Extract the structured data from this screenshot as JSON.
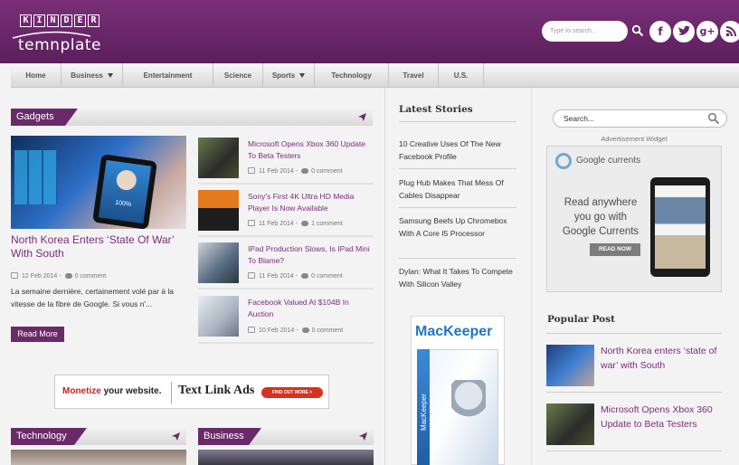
{
  "logo": {
    "top_letters": [
      "K",
      "I",
      "N",
      "D",
      "E",
      "R"
    ],
    "bottom": "temnplate"
  },
  "header": {
    "search_placeholder": "Type to search...",
    "social": [
      {
        "name": "facebook",
        "glyph": "f"
      },
      {
        "name": "twitter",
        "glyph": "t"
      },
      {
        "name": "google-plus",
        "glyph": "g+"
      },
      {
        "name": "rss",
        "glyph": "rss"
      }
    ]
  },
  "nav": {
    "items": [
      {
        "label": "Home",
        "dropdown": false
      },
      {
        "label": "Business",
        "dropdown": true
      },
      {
        "label": "Entertainment",
        "dropdown": false
      },
      {
        "label": "Science",
        "dropdown": false
      },
      {
        "label": "Sports",
        "dropdown": true
      },
      {
        "label": "Technology",
        "dropdown": false
      },
      {
        "label": "Travel",
        "dropdown": false
      },
      {
        "label": "U.S.",
        "dropdown": false
      }
    ]
  },
  "gadgets": {
    "title": "Gadgets",
    "featured": {
      "phone_screen": "100%",
      "title": "North Korea Enters ‘State Of War’ With South",
      "date": "12 Feb 2014",
      "comments": "0 comment",
      "excerpt": "La semaine dernière, certainement volé par à la vitesse de la fibre de Google. Si vous n'...",
      "read_more": "Read More"
    },
    "list": [
      {
        "title": "Microsoft Opens Xbox 360 Update To Beta Testers",
        "date": "11 Feb 2014",
        "comments": "0 comment"
      },
      {
        "title": "Sony's First 4K Ultra HD Media Player Is Now Available",
        "date": "11 Feb 2014",
        "comments": "1 comment"
      },
      {
        "title": "IPad Production Slows, Is IPad Mini To Blame?",
        "date": "11 Feb 2014",
        "comments": "0 comment"
      },
      {
        "title": "Facebook Valued At $104B In Auction",
        "date": "10 Feb 2014",
        "comments": "0 comment"
      }
    ]
  },
  "ad_banner": {
    "monetize": "Monetize",
    "your_website": "your website.",
    "brand": "Text Link Ads",
    "cta": "FIND OUT MORE >"
  },
  "technology": {
    "title": "Technology"
  },
  "business": {
    "title": "Business"
  },
  "latest": {
    "title": "Latest Stories",
    "items": [
      "10 Creative Uses Of The New Facebook Profile",
      "Plug Hub Makes That Mess Of Cables Disappear",
      "Samsung Beefs Up Chromebox With A Core I5 Processor",
      "Dylan: What It Takes To Compete With Silicon Valley"
    ]
  },
  "mackeeper": {
    "title": "MacKeeper",
    "side": "MacKeeper"
  },
  "sidebar": {
    "search_value": "Search...",
    "ad_widget_label": "Advertisement Widget",
    "gc": {
      "name": "Google currents",
      "text": "Read anywhere you go with Google Currents",
      "button": "READ NOW"
    },
    "popular_title": "Popular Post",
    "popular": [
      "North Korea enters ‘state of war’ with South",
      "Microsoft Opens Xbox 360 Update to Beta Testers"
    ]
  },
  "colors": {
    "purple": "#6a2a69",
    "link": "#7b2c7b"
  }
}
